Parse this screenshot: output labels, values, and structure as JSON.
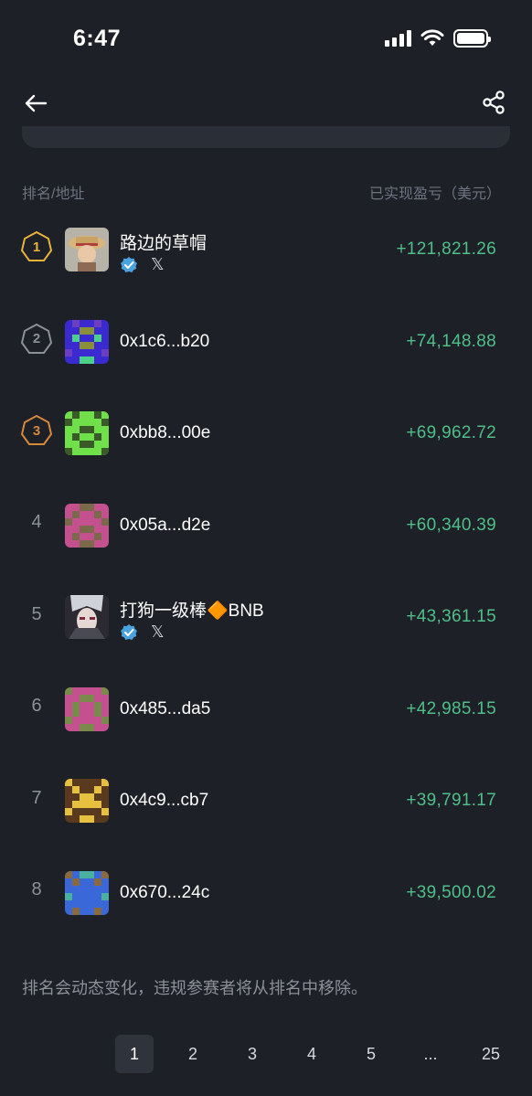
{
  "status": {
    "time": "6:47"
  },
  "header": {
    "col_rank": "排名/地址",
    "col_pnl": "已实现盈亏（美元）"
  },
  "rows": [
    {
      "rank": "1",
      "name": "路边的草帽",
      "value": "+121,821.26",
      "verified": true,
      "twitter": "𝕏",
      "medal": "gold"
    },
    {
      "rank": "2",
      "name": "0x1c6...b20",
      "value": "+74,148.88",
      "medal": "silver"
    },
    {
      "rank": "3",
      "name": "0xbb8...00e",
      "value": "+69,962.72",
      "medal": "bronze"
    },
    {
      "rank": "4",
      "name": "0x05a...d2e",
      "value": "+60,340.39"
    },
    {
      "rank": "5",
      "name": "打狗一级棒🔶BNB",
      "value": "+43,361.15",
      "verified": true,
      "twitter": "𝕏"
    },
    {
      "rank": "6",
      "name": "0x485...da5",
      "value": "+42,985.15"
    },
    {
      "rank": "7",
      "name": "0x4c9...cb7",
      "value": "+39,791.17"
    },
    {
      "rank": "8",
      "name": "0x670...24c",
      "value": "+39,500.02"
    }
  ],
  "footnote": "排名会动态变化，违规参赛者将从排名中移除。",
  "pagination": [
    "1",
    "2",
    "3",
    "4",
    "5",
    "...",
    "25"
  ],
  "colors": {
    "positive": "#4fbf8a",
    "gold": "#e8b33a",
    "silver": "#8b909a",
    "bronze": "#d6883e",
    "verified": "#4aa3df"
  }
}
